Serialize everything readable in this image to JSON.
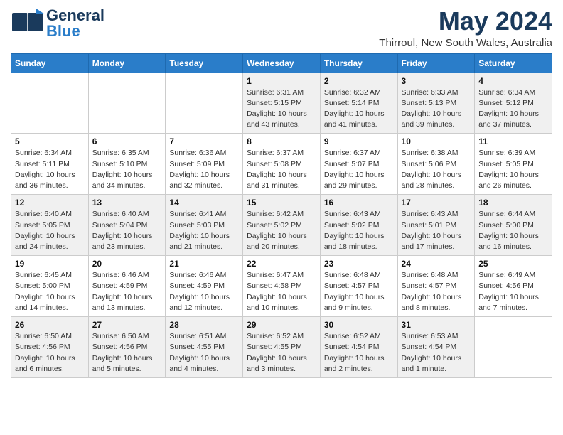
{
  "header": {
    "logo_general": "General",
    "logo_blue": "Blue",
    "month_title": "May 2024",
    "location": "Thirroul, New South Wales, Australia"
  },
  "weekdays": [
    "Sunday",
    "Monday",
    "Tuesday",
    "Wednesday",
    "Thursday",
    "Friday",
    "Saturday"
  ],
  "weeks": [
    [
      {
        "day": "",
        "detail": ""
      },
      {
        "day": "",
        "detail": ""
      },
      {
        "day": "",
        "detail": ""
      },
      {
        "day": "1",
        "detail": "Sunrise: 6:31 AM\nSunset: 5:15 PM\nDaylight: 10 hours\nand 43 minutes."
      },
      {
        "day": "2",
        "detail": "Sunrise: 6:32 AM\nSunset: 5:14 PM\nDaylight: 10 hours\nand 41 minutes."
      },
      {
        "day": "3",
        "detail": "Sunrise: 6:33 AM\nSunset: 5:13 PM\nDaylight: 10 hours\nand 39 minutes."
      },
      {
        "day": "4",
        "detail": "Sunrise: 6:34 AM\nSunset: 5:12 PM\nDaylight: 10 hours\nand 37 minutes."
      }
    ],
    [
      {
        "day": "5",
        "detail": "Sunrise: 6:34 AM\nSunset: 5:11 PM\nDaylight: 10 hours\nand 36 minutes."
      },
      {
        "day": "6",
        "detail": "Sunrise: 6:35 AM\nSunset: 5:10 PM\nDaylight: 10 hours\nand 34 minutes."
      },
      {
        "day": "7",
        "detail": "Sunrise: 6:36 AM\nSunset: 5:09 PM\nDaylight: 10 hours\nand 32 minutes."
      },
      {
        "day": "8",
        "detail": "Sunrise: 6:37 AM\nSunset: 5:08 PM\nDaylight: 10 hours\nand 31 minutes."
      },
      {
        "day": "9",
        "detail": "Sunrise: 6:37 AM\nSunset: 5:07 PM\nDaylight: 10 hours\nand 29 minutes."
      },
      {
        "day": "10",
        "detail": "Sunrise: 6:38 AM\nSunset: 5:06 PM\nDaylight: 10 hours\nand 28 minutes."
      },
      {
        "day": "11",
        "detail": "Sunrise: 6:39 AM\nSunset: 5:05 PM\nDaylight: 10 hours\nand 26 minutes."
      }
    ],
    [
      {
        "day": "12",
        "detail": "Sunrise: 6:40 AM\nSunset: 5:05 PM\nDaylight: 10 hours\nand 24 minutes."
      },
      {
        "day": "13",
        "detail": "Sunrise: 6:40 AM\nSunset: 5:04 PM\nDaylight: 10 hours\nand 23 minutes."
      },
      {
        "day": "14",
        "detail": "Sunrise: 6:41 AM\nSunset: 5:03 PM\nDaylight: 10 hours\nand 21 minutes."
      },
      {
        "day": "15",
        "detail": "Sunrise: 6:42 AM\nSunset: 5:02 PM\nDaylight: 10 hours\nand 20 minutes."
      },
      {
        "day": "16",
        "detail": "Sunrise: 6:43 AM\nSunset: 5:02 PM\nDaylight: 10 hours\nand 18 minutes."
      },
      {
        "day": "17",
        "detail": "Sunrise: 6:43 AM\nSunset: 5:01 PM\nDaylight: 10 hours\nand 17 minutes."
      },
      {
        "day": "18",
        "detail": "Sunrise: 6:44 AM\nSunset: 5:00 PM\nDaylight: 10 hours\nand 16 minutes."
      }
    ],
    [
      {
        "day": "19",
        "detail": "Sunrise: 6:45 AM\nSunset: 5:00 PM\nDaylight: 10 hours\nand 14 minutes."
      },
      {
        "day": "20",
        "detail": "Sunrise: 6:46 AM\nSunset: 4:59 PM\nDaylight: 10 hours\nand 13 minutes."
      },
      {
        "day": "21",
        "detail": "Sunrise: 6:46 AM\nSunset: 4:59 PM\nDaylight: 10 hours\nand 12 minutes."
      },
      {
        "day": "22",
        "detail": "Sunrise: 6:47 AM\nSunset: 4:58 PM\nDaylight: 10 hours\nand 10 minutes."
      },
      {
        "day": "23",
        "detail": "Sunrise: 6:48 AM\nSunset: 4:57 PM\nDaylight: 10 hours\nand 9 minutes."
      },
      {
        "day": "24",
        "detail": "Sunrise: 6:48 AM\nSunset: 4:57 PM\nDaylight: 10 hours\nand 8 minutes."
      },
      {
        "day": "25",
        "detail": "Sunrise: 6:49 AM\nSunset: 4:56 PM\nDaylight: 10 hours\nand 7 minutes."
      }
    ],
    [
      {
        "day": "26",
        "detail": "Sunrise: 6:50 AM\nSunset: 4:56 PM\nDaylight: 10 hours\nand 6 minutes."
      },
      {
        "day": "27",
        "detail": "Sunrise: 6:50 AM\nSunset: 4:56 PM\nDaylight: 10 hours\nand 5 minutes."
      },
      {
        "day": "28",
        "detail": "Sunrise: 6:51 AM\nSunset: 4:55 PM\nDaylight: 10 hours\nand 4 minutes."
      },
      {
        "day": "29",
        "detail": "Sunrise: 6:52 AM\nSunset: 4:55 PM\nDaylight: 10 hours\nand 3 minutes."
      },
      {
        "day": "30",
        "detail": "Sunrise: 6:52 AM\nSunset: 4:54 PM\nDaylight: 10 hours\nand 2 minutes."
      },
      {
        "day": "31",
        "detail": "Sunrise: 6:53 AM\nSunset: 4:54 PM\nDaylight: 10 hours\nand 1 minute."
      },
      {
        "day": "",
        "detail": ""
      }
    ]
  ]
}
